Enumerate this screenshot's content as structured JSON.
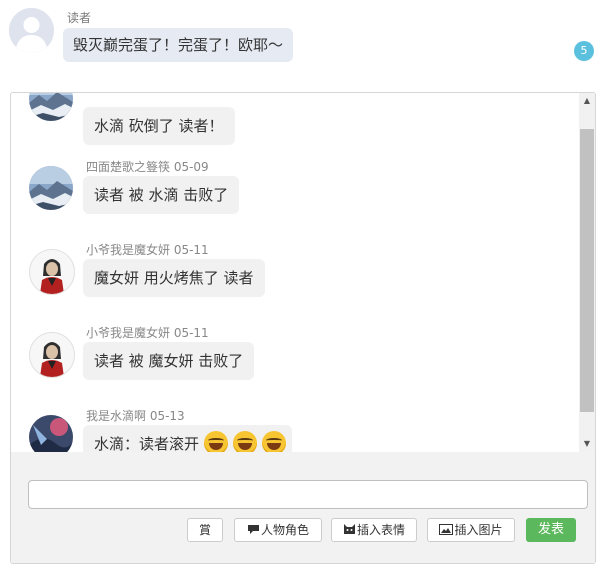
{
  "top_message": {
    "user": "读者",
    "text": "毁灭巅完蛋了！完蛋了！欧耶～",
    "reply_count": "5"
  },
  "messages": [
    {
      "meta": "",
      "text": "水滴 砍倒了 读者！",
      "avatar": "avatar-landscape"
    },
    {
      "meta": "四面楚歌之簦筷 05-09",
      "text": "读者 被 水滴 击败了",
      "avatar": "avatar-landscape"
    },
    {
      "meta": "小爷我是魔女妍 05-11",
      "text": "魔女妍 用火烤焦了 读者",
      "avatar": "avatar-character"
    },
    {
      "meta": "小爷我是魔女妍 05-11",
      "text": "读者 被 魔女妍 击败了",
      "avatar": "avatar-character"
    },
    {
      "meta": "我是水滴啊 05-13",
      "text": "水滴：读者滚开",
      "avatar": "avatar-dark",
      "emoji_count": 3
    }
  ],
  "composer": {
    "input_value": "",
    "buttons": {
      "reward": "賞",
      "character": "人物角色",
      "emoticon": "插入表情",
      "image": "插入图片",
      "submit": "发表"
    }
  },
  "colors": {
    "bubble": "#f1f1f1",
    "top_bubble": "#e6ebf3",
    "badge": "#5bc0de",
    "submit": "#5cb85c"
  }
}
